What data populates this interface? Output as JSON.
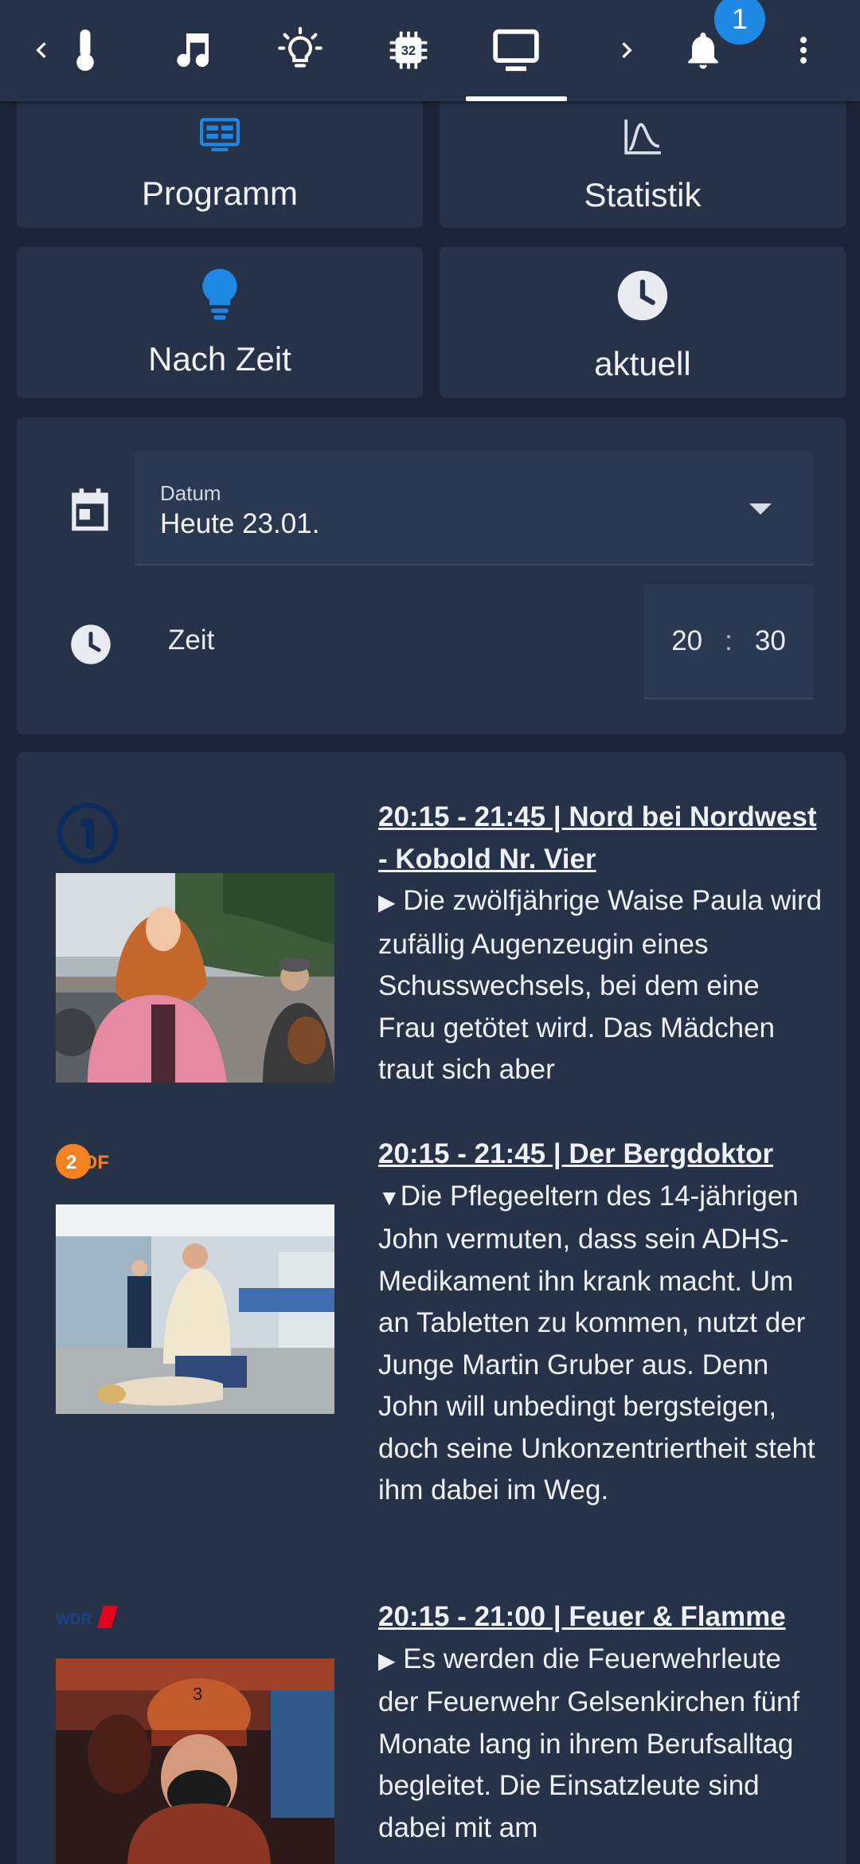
{
  "topbar": {
    "icons": [
      "chevron-left-icon",
      "thermometer-icon",
      "music-note-icon",
      "lightbulb-icon",
      "chip-icon",
      "tv-icon",
      "chevron-right-icon",
      "bell-icon",
      "more-vert-icon"
    ],
    "chip_text": "32",
    "active_tab": "tv-icon",
    "notification_count": "1"
  },
  "buttons": {
    "programm": "Programm",
    "statistik": "Statistik",
    "nach_zeit": "Nach Zeit",
    "aktuell": "aktuell"
  },
  "filters": {
    "date_label": "Datum",
    "date_value": "Heute 23.01.",
    "time_label": "Zeit",
    "hour": "20",
    "separator": ":",
    "minute": "30"
  },
  "colors": {
    "background": "#1c2537",
    "card": "#253248",
    "accent": "#1e88e5",
    "zdf_orange": "#f58220",
    "ard_blue": "#0d2a5c",
    "wdr_red": "#e3051b"
  },
  "programs": [
    {
      "channel": "ARD",
      "title": "20:15 - 21:45 | Nord bei Nordwest - Kobold Nr. Vier",
      "expanded": false,
      "marker": "▶",
      "description": "Die zwölfjährige Waise Paula wird zufällig Augenzeugin eines Schusswechsels, bei dem eine Frau getötet wird. Das Mädchen traut sich aber"
    },
    {
      "channel": "ZDF",
      "title": "20:15 - 21:45 | Der Bergdoktor",
      "expanded": true,
      "marker": "▼",
      "description": "Die Pflegeeltern des 14-jährigen John vermuten, dass sein ADHS-Medikament ihn krank macht. Um an Tabletten zu kommen, nutzt der Junge Martin Gruber aus. Denn John will unbedingt bergsteigen, doch seine Unkonzentriertheit steht ihm dabei im Weg."
    },
    {
      "channel": "WDR",
      "title": "20:15 - 21:00 | Feuer & Flamme",
      "expanded": false,
      "marker": "▶",
      "description": "Es werden die Feuerwehrleute der Feuerwehr Gelsenkirchen fünf Monate lang in ihrem Berufsalltag begleitet. Die Einsatzleute sind dabei mit am"
    }
  ]
}
